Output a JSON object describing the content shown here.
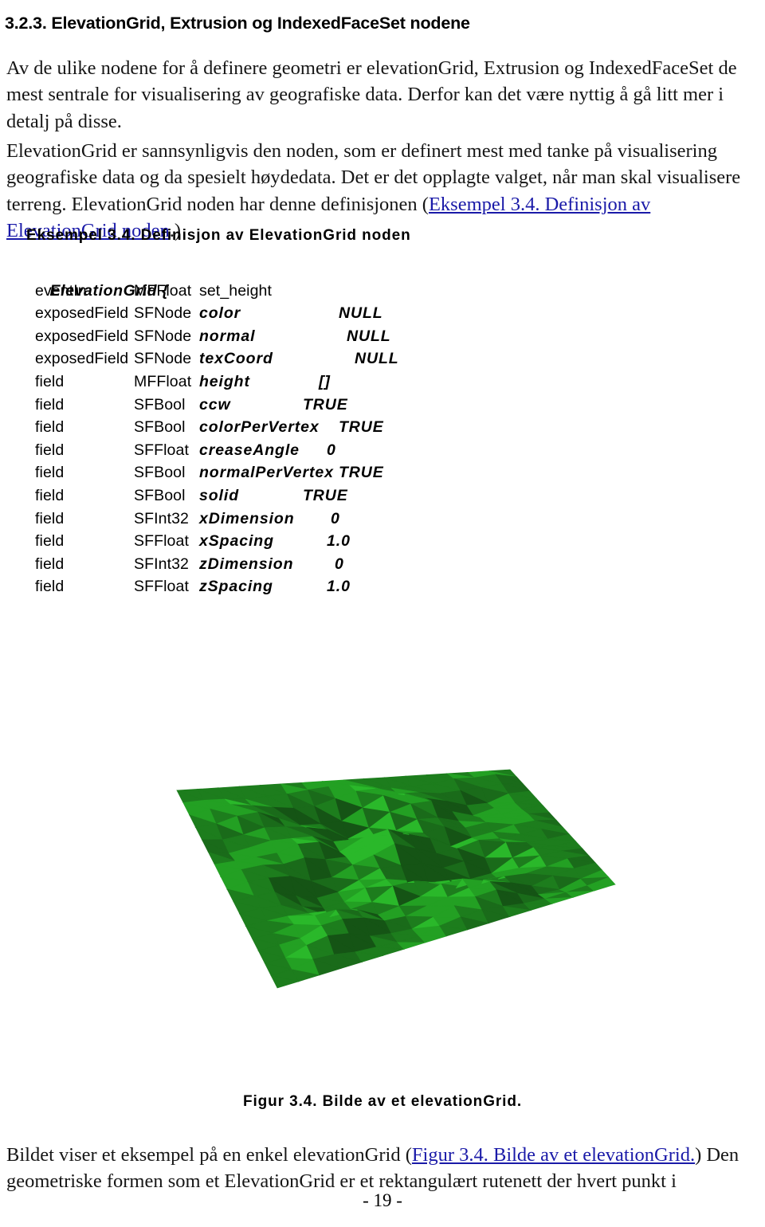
{
  "document": {
    "heading": "3.2.3. ElevationGrid, Extrusion og IndexedFaceSet nodene",
    "page_number": "- 19 -"
  },
  "paragraphs": {
    "p1": "Av de ulike nodene for å definere geometri er elevationGrid, Extrusion og IndexedFaceSet de mest sentrale for visualisering av geografiske data. Derfor kan det være nyttig å gå litt mer i detalj på disse.",
    "p2_a": "ElevationGrid er sannsynligvis den noden, som er definert mest med tanke på visualisering geografiske data og da spesielt høydedata. Det er det opplagte valget, når man skal visualisere terreng. ElevationGrid noden har denne definisjonen (",
    "p2_link": "Eksempel 3.4. Definisjon av ElevationGrid noden",
    "p2_b": ".)",
    "p3_a": "Bildet viser et eksempel på en enkel elevationGrid (",
    "p3_link": "Figur 3.4. Bilde av et elevationGrid.",
    "p3_b": ") Den geometriske formen som et ElevationGrid er et rektangulært rutenett der hvert punkt i"
  },
  "example": {
    "title": "Eksempel 3.4. Definisjon av ElevationGrid noden",
    "open_line": "ElevationGrid {",
    "close_line": "}",
    "fields": [
      {
        "access": "eventIn",
        "type": "MFFloat",
        "name": "set_height",
        "value": "",
        "name_bold": false
      },
      {
        "access": "exposedField",
        "type": "SFNode",
        "name": "color",
        "value": "NULL",
        "name_bold": true
      },
      {
        "access": "exposedField",
        "type": "SFNode",
        "name": "normal",
        "value": "NULL",
        "name_bold": true
      },
      {
        "access": "exposedField",
        "type": "SFNode",
        "name": "texCoord",
        "value": "NULL",
        "name_bold": true
      },
      {
        "access": "field",
        "type": "MFFloat",
        "name": "height",
        "value": "[]",
        "name_bold": true
      },
      {
        "access": "field",
        "type": "SFBool",
        "name": "ccw",
        "value": "TRUE",
        "name_bold": true
      },
      {
        "access": "field",
        "type": "SFBool",
        "name": "colorPerVertex",
        "value": "TRUE",
        "name_bold": true
      },
      {
        "access": "field",
        "type": "SFFloat",
        "name": "creaseAngle",
        "value": "0",
        "name_bold": true
      },
      {
        "access": "field",
        "type": "SFBool",
        "name": "normalPerVertex",
        "value": "TRUE",
        "name_bold": true
      },
      {
        "access": "field",
        "type": "SFBool",
        "name": "solid",
        "value": "TRUE",
        "name_bold": true
      },
      {
        "access": "field",
        "type": "SFInt32",
        "name": "xDimension",
        "value": "0",
        "name_bold": true
      },
      {
        "access": "field",
        "type": "SFFloat",
        "name": "xSpacing",
        "value": "1.0",
        "name_bold": true
      },
      {
        "access": "field",
        "type": "SFInt32",
        "name": "zDimension",
        "value": "0",
        "name_bold": true
      },
      {
        "access": "field",
        "type": "SFFloat",
        "name": "zSpacing",
        "value": "1.0",
        "name_bold": true
      }
    ]
  },
  "figure": {
    "caption": "Figur 3.4. Bilde av et elevationGrid.",
    "alt": "Low-polygon green elevation grid terrain surface rendered in 3D perspective",
    "colors": {
      "darkest": "#155415",
      "dark": "#1a6b1a",
      "mid": "#1d7d1d",
      "light": "#23a023",
      "lightest": "#2ab82a",
      "background": "#ffffff"
    }
  },
  "link_color": "#1a1aa8"
}
